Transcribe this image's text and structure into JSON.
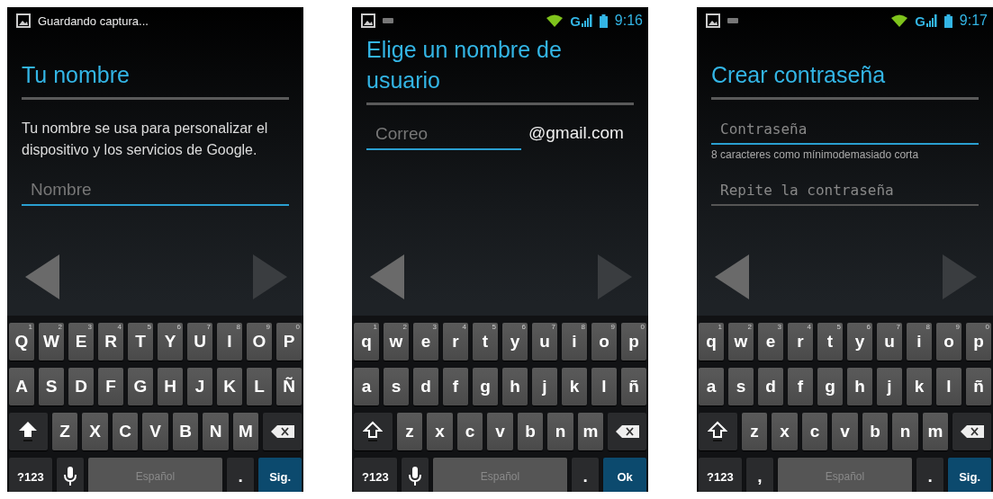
{
  "screens": [
    {
      "status_bar": {
        "notification": "Guardando captura..."
      },
      "title": "Tu nombre",
      "description": "Tu nombre se usa para personalizar el dispositivo y los servicios de Google.",
      "fields": [
        {
          "kind": "text",
          "placeholder": "Nombre",
          "focused": true
        }
      ],
      "nav": {
        "back_enabled": true,
        "next_enabled": false
      },
      "keyboard": {
        "shift": true,
        "rows": [
          {
            "keys": [
              {
                "kind": "letter",
                "label": "Q",
                "hint": "1"
              },
              {
                "kind": "letter",
                "label": "W",
                "hint": "2"
              },
              {
                "kind": "letter",
                "label": "E",
                "hint": "3"
              },
              {
                "kind": "letter",
                "label": "R",
                "hint": "4"
              },
              {
                "kind": "letter",
                "label": "T",
                "hint": "5"
              },
              {
                "kind": "letter",
                "label": "Y",
                "hint": "6"
              },
              {
                "kind": "letter",
                "label": "U",
                "hint": "7"
              },
              {
                "kind": "letter",
                "label": "I",
                "hint": "8"
              },
              {
                "kind": "letter",
                "label": "O",
                "hint": "9"
              },
              {
                "kind": "letter",
                "label": "P",
                "hint": "0"
              }
            ]
          },
          {
            "keys": [
              {
                "kind": "letter",
                "label": "A"
              },
              {
                "kind": "letter",
                "label": "S"
              },
              {
                "kind": "letter",
                "label": "D"
              },
              {
                "kind": "letter",
                "label": "F"
              },
              {
                "kind": "letter",
                "label": "G"
              },
              {
                "kind": "letter",
                "label": "H"
              },
              {
                "kind": "letter",
                "label": "J"
              },
              {
                "kind": "letter",
                "label": "K"
              },
              {
                "kind": "letter",
                "label": "L"
              },
              {
                "kind": "letter",
                "label": "Ñ"
              }
            ]
          },
          {
            "keys": [
              {
                "kind": "shift"
              },
              {
                "kind": "letter",
                "label": "Z"
              },
              {
                "kind": "letter",
                "label": "X"
              },
              {
                "kind": "letter",
                "label": "C"
              },
              {
                "kind": "letter",
                "label": "V"
              },
              {
                "kind": "letter",
                "label": "B"
              },
              {
                "kind": "letter",
                "label": "N"
              },
              {
                "kind": "letter",
                "label": "M"
              },
              {
                "kind": "backspace"
              }
            ]
          },
          {
            "keys": [
              {
                "kind": "symbols",
                "label": "?123"
              },
              {
                "kind": "mic"
              },
              {
                "kind": "space",
                "label": "Español"
              },
              {
                "kind": "punct",
                "label": "."
              },
              {
                "kind": "action",
                "label": "Sig."
              }
            ]
          }
        ]
      }
    },
    {
      "status_bar": {
        "network": "G",
        "time": "9:16"
      },
      "title": "Elige un nombre de usuario",
      "fields": [
        {
          "kind": "text",
          "placeholder": "Correo",
          "focused": true,
          "suffix": "@gmail.com"
        }
      ],
      "nav": {
        "back_enabled": true,
        "next_enabled": false
      },
      "keyboard": {
        "shift": false,
        "rows": [
          {
            "keys": [
              {
                "kind": "letter",
                "label": "q",
                "hint": "1"
              },
              {
                "kind": "letter",
                "label": "w",
                "hint": "2"
              },
              {
                "kind": "letter",
                "label": "e",
                "hint": "3"
              },
              {
                "kind": "letter",
                "label": "r",
                "hint": "4"
              },
              {
                "kind": "letter",
                "label": "t",
                "hint": "5"
              },
              {
                "kind": "letter",
                "label": "y",
                "hint": "6"
              },
              {
                "kind": "letter",
                "label": "u",
                "hint": "7"
              },
              {
                "kind": "letter",
                "label": "i",
                "hint": "8"
              },
              {
                "kind": "letter",
                "label": "o",
                "hint": "9"
              },
              {
                "kind": "letter",
                "label": "p",
                "hint": "0"
              }
            ]
          },
          {
            "keys": [
              {
                "kind": "letter",
                "label": "a"
              },
              {
                "kind": "letter",
                "label": "s"
              },
              {
                "kind": "letter",
                "label": "d"
              },
              {
                "kind": "letter",
                "label": "f"
              },
              {
                "kind": "letter",
                "label": "g"
              },
              {
                "kind": "letter",
                "label": "h"
              },
              {
                "kind": "letter",
                "label": "j"
              },
              {
                "kind": "letter",
                "label": "k"
              },
              {
                "kind": "letter",
                "label": "l"
              },
              {
                "kind": "letter",
                "label": "ñ"
              }
            ]
          },
          {
            "keys": [
              {
                "kind": "shift"
              },
              {
                "kind": "letter",
                "label": "z"
              },
              {
                "kind": "letter",
                "label": "x"
              },
              {
                "kind": "letter",
                "label": "c"
              },
              {
                "kind": "letter",
                "label": "v"
              },
              {
                "kind": "letter",
                "label": "b"
              },
              {
                "kind": "letter",
                "label": "n"
              },
              {
                "kind": "letter",
                "label": "m"
              },
              {
                "kind": "backspace"
              }
            ]
          },
          {
            "keys": [
              {
                "kind": "symbols",
                "label": "?123"
              },
              {
                "kind": "mic"
              },
              {
                "kind": "space",
                "label": "Español"
              },
              {
                "kind": "punct",
                "label": "."
              },
              {
                "kind": "action",
                "label": "Ok"
              }
            ]
          }
        ]
      }
    },
    {
      "status_bar": {
        "network": "G",
        "time": "9:17"
      },
      "title": "Crear contraseña",
      "fields": [
        {
          "kind": "password",
          "placeholder": "Contraseña",
          "focused": true,
          "hint": "8 caracteres como mínimodemasiado corta"
        },
        {
          "kind": "password",
          "placeholder": "Repite la contraseña",
          "focused": false
        }
      ],
      "nav": {
        "back_enabled": true,
        "next_enabled": false
      },
      "keyboard": {
        "shift": false,
        "rows": [
          {
            "keys": [
              {
                "kind": "letter",
                "label": "q",
                "hint": "1"
              },
              {
                "kind": "letter",
                "label": "w",
                "hint": "2"
              },
              {
                "kind": "letter",
                "label": "e",
                "hint": "3"
              },
              {
                "kind": "letter",
                "label": "r",
                "hint": "4"
              },
              {
                "kind": "letter",
                "label": "t",
                "hint": "5"
              },
              {
                "kind": "letter",
                "label": "y",
                "hint": "6"
              },
              {
                "kind": "letter",
                "label": "u",
                "hint": "7"
              },
              {
                "kind": "letter",
                "label": "i",
                "hint": "8"
              },
              {
                "kind": "letter",
                "label": "o",
                "hint": "9"
              },
              {
                "kind": "letter",
                "label": "p",
                "hint": "0"
              }
            ]
          },
          {
            "keys": [
              {
                "kind": "letter",
                "label": "a"
              },
              {
                "kind": "letter",
                "label": "s"
              },
              {
                "kind": "letter",
                "label": "d"
              },
              {
                "kind": "letter",
                "label": "f"
              },
              {
                "kind": "letter",
                "label": "g"
              },
              {
                "kind": "letter",
                "label": "h"
              },
              {
                "kind": "letter",
                "label": "j"
              },
              {
                "kind": "letter",
                "label": "k"
              },
              {
                "kind": "letter",
                "label": "l"
              },
              {
                "kind": "letter",
                "label": "ñ"
              }
            ]
          },
          {
            "keys": [
              {
                "kind": "shift"
              },
              {
                "kind": "letter",
                "label": "z"
              },
              {
                "kind": "letter",
                "label": "x"
              },
              {
                "kind": "letter",
                "label": "c"
              },
              {
                "kind": "letter",
                "label": "v"
              },
              {
                "kind": "letter",
                "label": "b"
              },
              {
                "kind": "letter",
                "label": "n"
              },
              {
                "kind": "letter",
                "label": "m"
              },
              {
                "kind": "backspace"
              }
            ]
          },
          {
            "keys": [
              {
                "kind": "symbols",
                "label": "?123"
              },
              {
                "kind": "punct",
                "label": ","
              },
              {
                "kind": "space",
                "label": "Español"
              },
              {
                "kind": "punct",
                "label": "."
              },
              {
                "kind": "action",
                "label": "Sig."
              }
            ]
          }
        ]
      }
    }
  ]
}
